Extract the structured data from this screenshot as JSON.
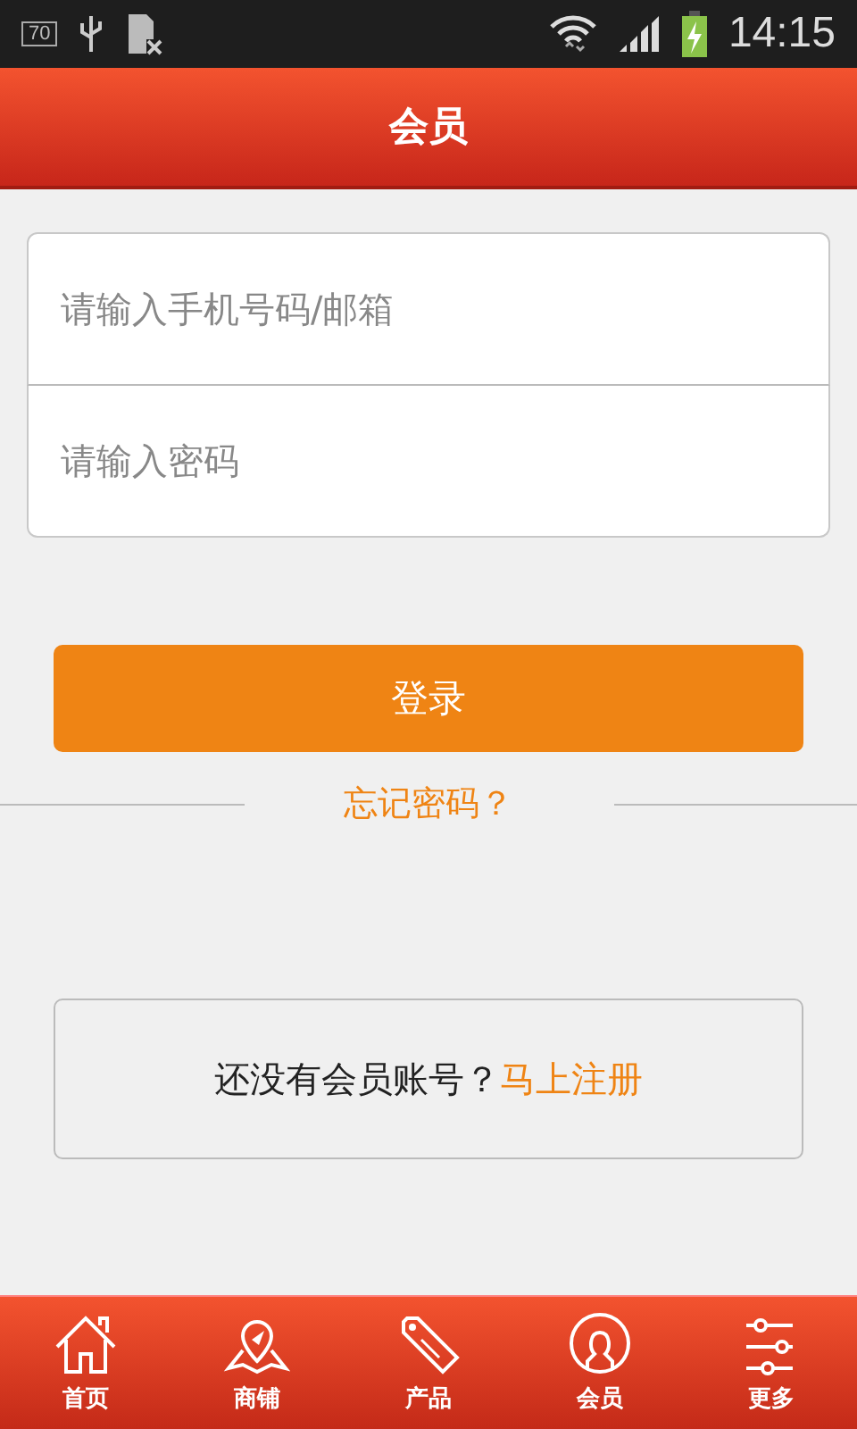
{
  "status_bar": {
    "badge": "70",
    "time": "14:15"
  },
  "header": {
    "title": "会员"
  },
  "login_form": {
    "account_placeholder": "请输入手机号码/邮箱",
    "password_placeholder": "请输入密码",
    "login_button": "登录",
    "forgot_link": "忘记密码？"
  },
  "register_prompt": {
    "text": "还没有会员账号？",
    "link": "马上注册"
  },
  "tab_bar": [
    {
      "kind": "home",
      "label": "首页"
    },
    {
      "kind": "shop",
      "label": "商铺"
    },
    {
      "kind": "product",
      "label": "产品"
    },
    {
      "kind": "member",
      "label": "会员"
    },
    {
      "kind": "more",
      "label": "更多"
    }
  ]
}
